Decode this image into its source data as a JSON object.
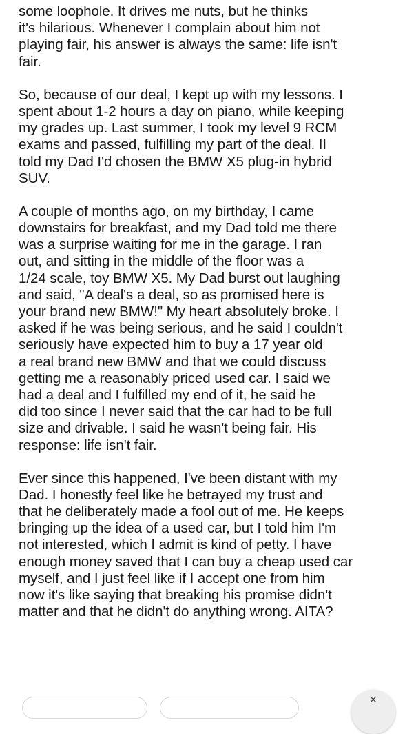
{
  "post": {
    "paragraphs": [
      {
        "lines": [
          "some loophole. It drives me nuts, but he thinks",
          "it's hilarious.  Whenever I complain about him not",
          "playing fair, his answer is always the same: life isn't",
          "fair."
        ]
      },
      {
        "lines": [
          "So, because of our deal, I kept up with my lessons. I",
          "spent about 1-2 hours a day on piano, while keeping",
          "my grades up. Last summer, I took my level 9 RCM",
          "exams and passed, fulfilling my part of the deal. II",
          "told my Dad I'd chosen the BMW X5 plug-in hybrid",
          "SUV."
        ]
      },
      {
        "lines": [
          "A couple of months ago, on my birthday, I came",
          "downstairs for breakfast, and my Dad told me there",
          "was a surprise waiting for me in the garage. I ran",
          "out, and sitting in the middle of the floor was a",
          "1/24 scale, toy BMW X5. My Dad burst out laughing",
          "and said, \"A deal's a deal, so as promised here is",
          "your brand new BMW!\" My heart absolutely broke. I",
          "asked if he was being serious, and he said I couldn't",
          "seriously have expected him to buy a 17 year old",
          "a real brand new BMW and that we could discuss",
          "getting me a reasonably priced used car. I said we",
          "had a deal and I fulfilled my end of it, he said he",
          "did too since I never said that the car had to be full",
          "size and drivable. I said he wasn't being fair. His",
          "response: life isn't fair."
        ]
      },
      {
        "lines": [
          "Ever since this happened, I've been distant with my",
          "Dad. I honestly feel like he betrayed my trust and",
          "that he deliberately made a fool out of me. He keeps",
          "bringing up the idea of a used car, but I told him I'm",
          "not interested, which I admit is kind of petty. I have",
          "enough money saved that I can buy a cheap used car",
          "myself, and I just feel like if I accept one from him",
          "now it's like saying that breaking his promise didn't",
          "matter and that he didn't do anything wrong. AITA?"
        ]
      }
    ]
  },
  "bottom_bar": {
    "fab_icon": "close-icon",
    "fab_glyph": "✕"
  }
}
